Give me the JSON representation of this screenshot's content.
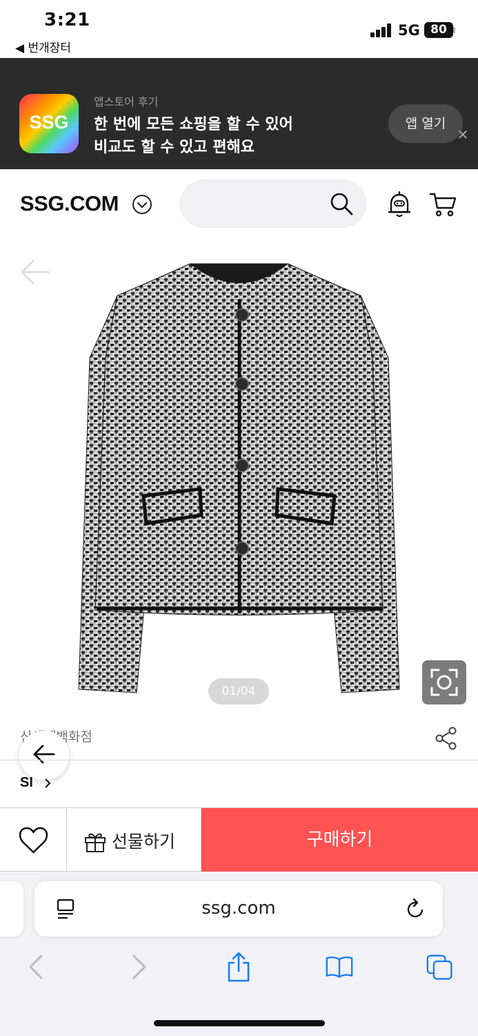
{
  "status_bar": {
    "time": "3:21",
    "back_app": "◀ 번개장터",
    "network": "5G",
    "battery": "80"
  },
  "app_banner": {
    "logo_text": "SSG",
    "subtitle": "앱스토어 후기",
    "line1": "한 번에 모든 쇼핑을 할 수 있어",
    "line2": "비교도 할 수 있고 편해요",
    "open_button": "앱 열기",
    "close_glyph": "✕"
  },
  "header": {
    "logo": "SSG.COM",
    "search_placeholder": ""
  },
  "product": {
    "image_counter": "01/04",
    "store_name": "신세계백화점",
    "brand": "SI"
  },
  "buy_bar": {
    "gift_label": "선물하기",
    "buy_label": "구매하기"
  },
  "safari": {
    "url": "ssg.com"
  },
  "colors": {
    "accent_red": "#ff5252",
    "banner_bg": "#2b2b2b",
    "safari_blue": "#1a7cf5"
  }
}
